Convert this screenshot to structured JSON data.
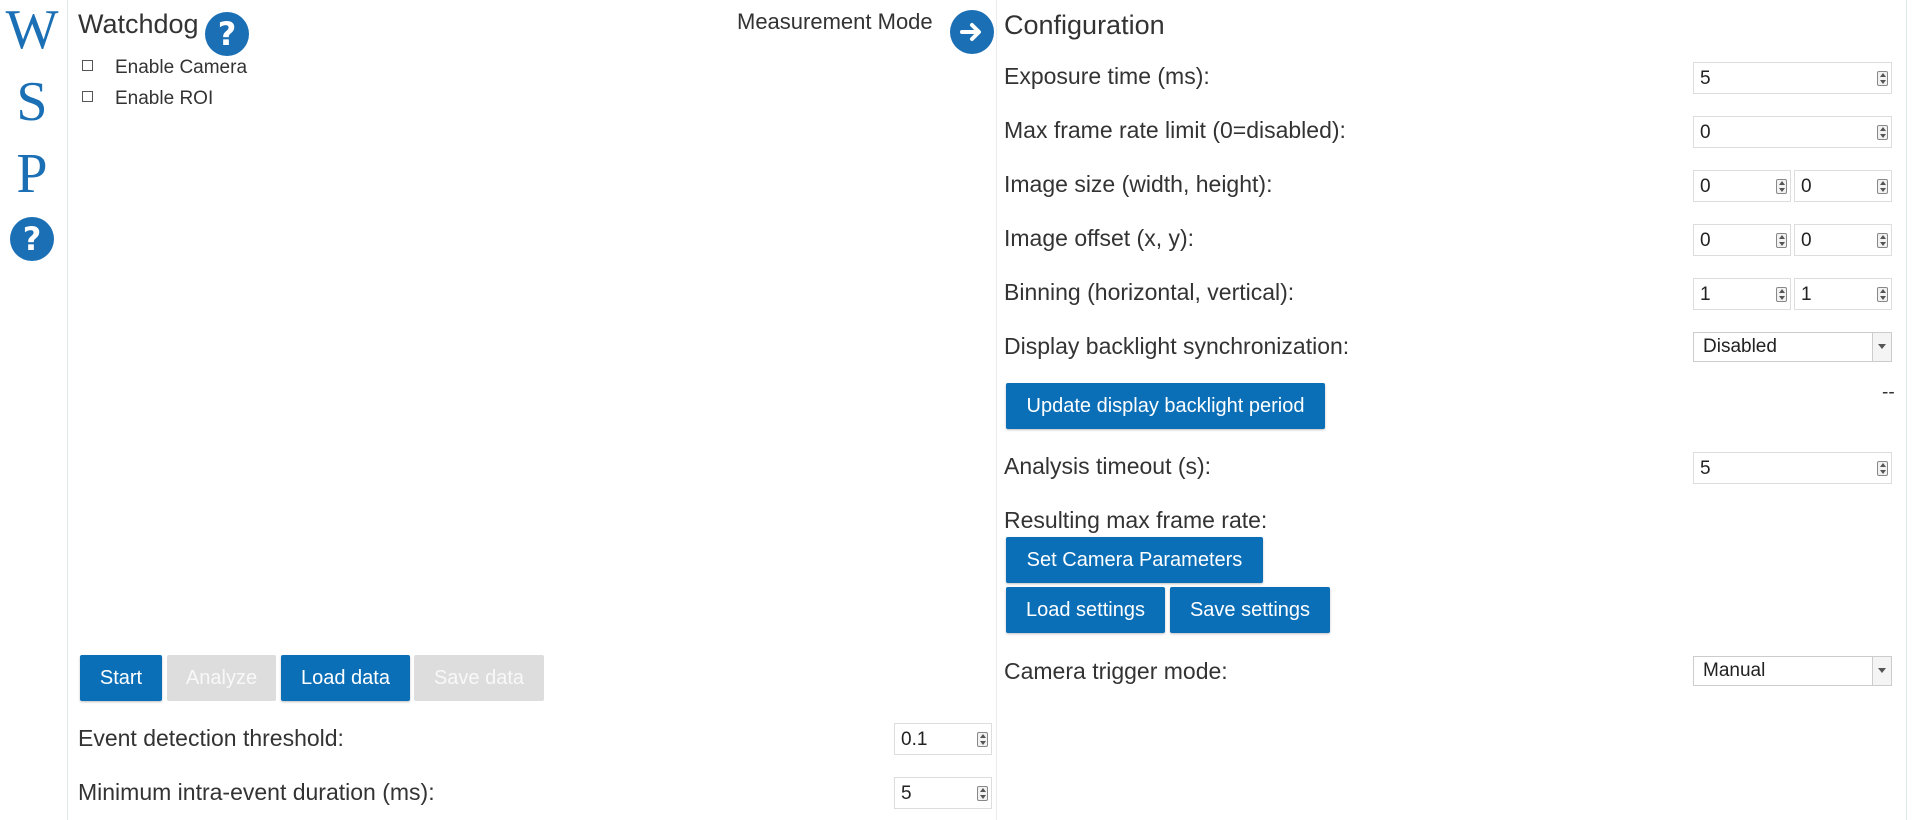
{
  "brand": {
    "letters": [
      "W",
      "S",
      "P"
    ],
    "help_glyph": "?"
  },
  "left_panel": {
    "title": "Watchdog",
    "help_glyph": "?",
    "mode_label": "Measurement Mode",
    "mode_icon": "arrow-right-circle-icon",
    "checkboxes": [
      {
        "label": "Enable Camera",
        "checked": false
      },
      {
        "label": "Enable ROI",
        "checked": false
      }
    ],
    "buttons": {
      "start": "Start",
      "analyze": "Analyze",
      "load_data": "Load data",
      "save_data": "Save data"
    },
    "fields": {
      "threshold_label": "Event detection threshold:",
      "threshold_value": "0.1",
      "duration_label": "Minimum intra-event duration (ms):",
      "duration_value": "5"
    }
  },
  "config": {
    "title": "Configuration",
    "exposure_label": "Exposure time (ms):",
    "exposure_value": "5",
    "max_frame_label": "Max frame rate limit (0=disabled):",
    "max_frame_value": "0",
    "image_size_label": "Image size (width, height):",
    "image_size_width": "0",
    "image_size_height": "0",
    "image_offset_label": "Image offset (x, y):",
    "image_offset_x": "0",
    "image_offset_y": "0",
    "binning_label": "Binning (horizontal, vertical):",
    "binning_h": "1",
    "binning_v": "1",
    "backlight_label": "Display backlight synchronization:",
    "backlight_value": "Disabled",
    "update_backlight_button": "Update display backlight period",
    "backlight_period_value": "--",
    "analysis_timeout_label": "Analysis timeout (s):",
    "analysis_timeout_value": "5",
    "resulting_rate_label": "Resulting max frame rate:",
    "set_params_button": "Set Camera Parameters",
    "load_settings_button": "Load settings",
    "save_settings_button": "Save settings",
    "trigger_label": "Camera trigger mode:",
    "trigger_value": "Manual"
  },
  "colors": {
    "accent": "#0b6fb8",
    "brand": "#1a6fb5",
    "disabled": "#dddddd"
  }
}
